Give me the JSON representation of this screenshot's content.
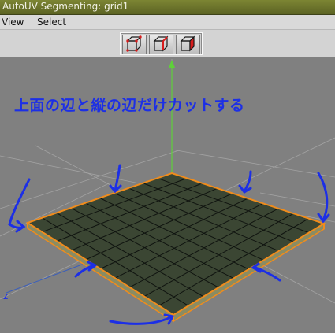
{
  "window": {
    "title": "AutoUV Segmenting: grid1"
  },
  "menu": {
    "items": [
      "View",
      "Select"
    ]
  },
  "toolbar": {
    "buttons": [
      {
        "name": "cube-mode-1-icon"
      },
      {
        "name": "cube-mode-2-icon"
      },
      {
        "name": "cube-mode-3-icon"
      }
    ]
  },
  "viewport": {
    "axis_label": "z",
    "annotation": "上面の辺と縦の辺だけカットする",
    "colors": {
      "background": "#808080",
      "grid_fill": "#3b4633",
      "selected_edge": "#f08c1c",
      "annotation": "#1c2fe6",
      "axis_y": "#5fcf3a"
    }
  }
}
